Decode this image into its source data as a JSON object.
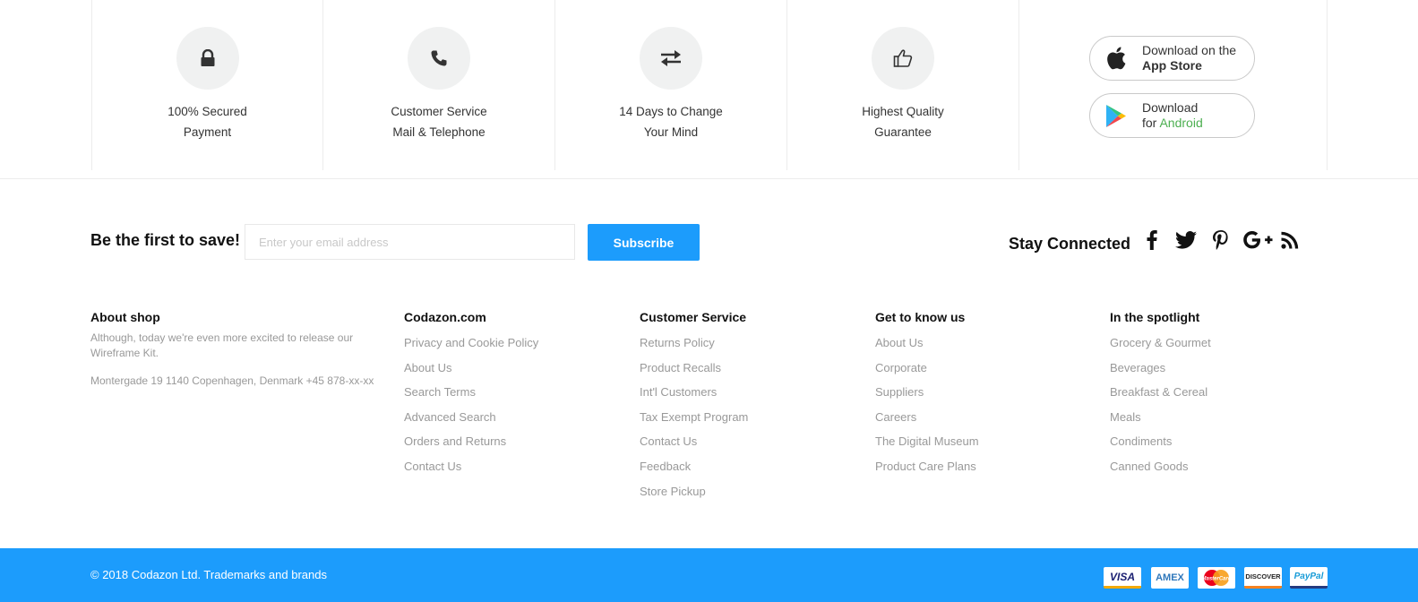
{
  "features": [
    {
      "line1": "100% Secured",
      "line2": "Payment",
      "icon": "lock-icon"
    },
    {
      "line1": "Customer Service",
      "line2": "Mail & Telephone",
      "icon": "phone-icon"
    },
    {
      "line1": "14 Days to Change",
      "line2": "Your Mind",
      "icon": "exchange-icon"
    },
    {
      "line1": "Highest Quality",
      "line2": "Guarantee",
      "icon": "thumbs-up-icon"
    }
  ],
  "apps": {
    "appstore": {
      "line1": "Download on the",
      "line2": "App Store"
    },
    "android": {
      "line1": "Download",
      "line2_prefix": "for",
      "line2_highlight": "Android"
    }
  },
  "newsletter": {
    "title": "Be the first to save!",
    "placeholder": "Enter your email address",
    "button": "Subscribe"
  },
  "social": {
    "title": "Stay Connected",
    "icons": [
      "facebook-icon",
      "twitter-icon",
      "pinterest-icon",
      "google-plus-icon",
      "rss-icon"
    ]
  },
  "columns": {
    "about": {
      "title": "About shop",
      "text": "Although, today we're even more excited to release our Wireframe Kit.",
      "address": "Montergade 19 1140 Copenhagen, Denmark +45 878-xx-xx"
    },
    "codazon": {
      "title": "Codazon.com",
      "items": [
        "Privacy and Cookie Policy",
        "About Us",
        "Search Terms",
        "Advanced Search",
        "Orders and Returns",
        "Contact Us"
      ]
    },
    "service": {
      "title": "Customer Service",
      "items": [
        "Returns Policy",
        "Product Recalls",
        "Int'l Customers",
        "Tax Exempt Program",
        "Contact Us",
        "Feedback",
        "Store Pickup"
      ]
    },
    "know": {
      "title": "Get to know us",
      "items": [
        "About Us",
        "Corporate",
        "Suppliers",
        "Careers",
        "The Digital Museum",
        "Product Care Plans"
      ]
    },
    "spotlight": {
      "title": "In the spotlight",
      "items": [
        "Grocery & Gourmet",
        "Beverages",
        "Breakfast & Cereal",
        "Meals",
        "Condiments",
        "Canned Goods"
      ]
    }
  },
  "bottom": {
    "copyright": "© 2018 Codazon Ltd. Trademarks and brands",
    "payments": [
      "VISA",
      "AMEX",
      "MasterCard",
      "DISCOVER",
      "PayPal"
    ]
  },
  "colors": {
    "accent": "#1c9cfc",
    "android_green": "#4caf50"
  }
}
